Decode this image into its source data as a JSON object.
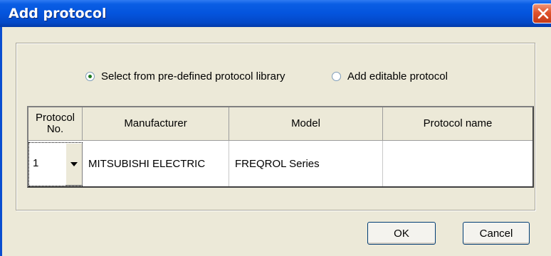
{
  "dialog": {
    "title": "Add protocol"
  },
  "options": {
    "predefined_label": "Select from pre-defined protocol library",
    "predefined_selected": true,
    "editable_label": "Add editable protocol",
    "editable_selected": false
  },
  "table": {
    "headers": {
      "protocol_no": "Protocol No.",
      "manufacturer": "Manufacturer",
      "model": "Model",
      "protocol_name": "Protocol name"
    },
    "rows": [
      {
        "protocol_no": "1",
        "manufacturer": "MITSUBISHI ELECTRIC",
        "model": "FREQROL Series",
        "protocol_name": ""
      }
    ]
  },
  "buttons": {
    "ok": "OK",
    "cancel": "Cancel"
  },
  "icons": {
    "close": "close-icon",
    "dropdown": "chevron-down-icon"
  },
  "colors": {
    "titlebar": "#0454dd",
    "close_button": "#e0532c",
    "dialog_background": "#ece9d8"
  }
}
